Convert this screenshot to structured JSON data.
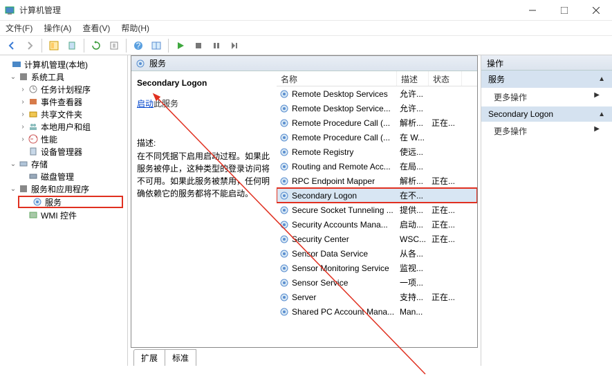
{
  "window": {
    "title": "计算机管理"
  },
  "menubar": {
    "file": "文件(F)",
    "action": "操作(A)",
    "view": "查看(V)",
    "help": "帮助(H)"
  },
  "tree": {
    "root": "计算机管理(本地)",
    "systools": "系统工具",
    "task": "任务计划程序",
    "event": "事件查看器",
    "shared": "共享文件夹",
    "users": "本地用户和组",
    "perf": "性能",
    "devmgr": "设备管理器",
    "storage": "存储",
    "disk": "磁盘管理",
    "svcapps": "服务和应用程序",
    "services": "服务",
    "wmi": "WMI 控件"
  },
  "center": {
    "header": "服务",
    "selected_title": "Secondary Logon",
    "start_link": "启动",
    "start_rest": "此服务",
    "desc_label": "描述:",
    "desc_body": "在不同凭据下启用启动过程。如果此服务被停止，这种类型的登录访问将不可用。如果此服务被禁用，任何明确依赖它的服务都将不能启动。",
    "cols": {
      "name": "名称",
      "desc": "描述",
      "state": "状态"
    },
    "rows": [
      {
        "n": "Remote Desktop Services",
        "d": "允许...",
        "s": ""
      },
      {
        "n": "Remote Desktop Service...",
        "d": "允许...",
        "s": ""
      },
      {
        "n": "Remote Procedure Call (...",
        "d": "解析...",
        "s": "正在..."
      },
      {
        "n": "Remote Procedure Call (...",
        "d": "在 W...",
        "s": ""
      },
      {
        "n": "Remote Registry",
        "d": "使远...",
        "s": ""
      },
      {
        "n": "Routing and Remote Acc...",
        "d": "在局...",
        "s": ""
      },
      {
        "n": "RPC Endpoint Mapper",
        "d": "解析...",
        "s": "正在..."
      },
      {
        "n": "Secondary Logon",
        "d": "在不...",
        "s": ""
      },
      {
        "n": "Secure Socket Tunneling ...",
        "d": "提供...",
        "s": "正在..."
      },
      {
        "n": "Security Accounts Mana...",
        "d": "启动...",
        "s": "正在..."
      },
      {
        "n": "Security Center",
        "d": "WSC...",
        "s": "正在..."
      },
      {
        "n": "Sensor Data Service",
        "d": "从各...",
        "s": ""
      },
      {
        "n": "Sensor Monitoring Service",
        "d": "监视...",
        "s": ""
      },
      {
        "n": "Sensor Service",
        "d": "一项...",
        "s": ""
      },
      {
        "n": "Server",
        "d": "支持...",
        "s": "正在..."
      },
      {
        "n": "Shared PC Account Mana...",
        "d": "Man...",
        "s": ""
      }
    ],
    "tabs": {
      "ext": "扩展",
      "std": "标准"
    }
  },
  "actions": {
    "header": "操作",
    "sec1": "服务",
    "more": "更多操作",
    "sec2": "Secondary Logon"
  }
}
